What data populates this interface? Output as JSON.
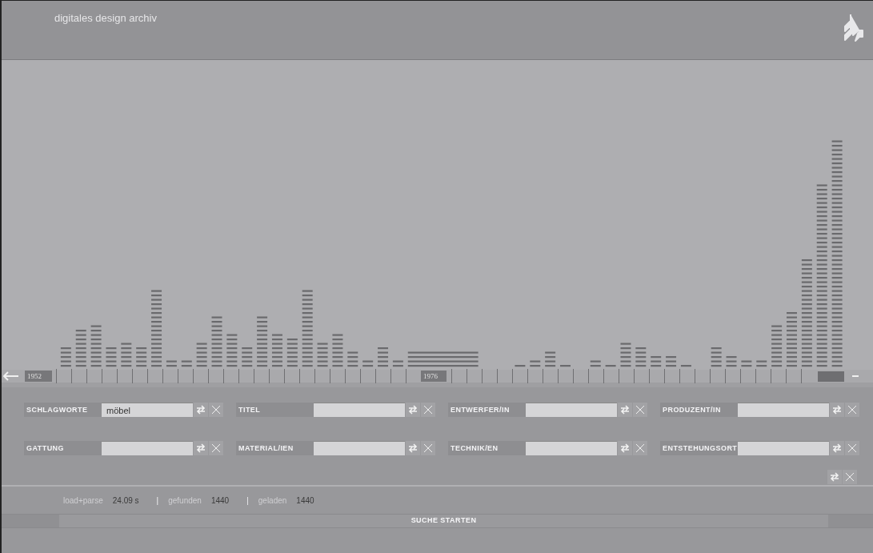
{
  "header": {
    "title": "digitales design archiv"
  },
  "timeline": {
    "start_label": "1952",
    "mid_label": "1976"
  },
  "fields": [
    {
      "label": "SCHLAGWORTE",
      "value": "möbel"
    },
    {
      "label": "TITEL"
    },
    {
      "label": "ENTWERFER/IN"
    },
    {
      "label": "PRODUZENT/IN"
    },
    {
      "label": "GATTUNG"
    },
    {
      "label": "MATERIAL/IEN"
    },
    {
      "label": "TECHNIK/EN"
    },
    {
      "label": "ENTSTEHUNGSORT"
    }
  ],
  "status": [
    {
      "label": "load+parse",
      "value": "24.09 s"
    },
    {
      "separator": "|",
      "label": "gefunden",
      "value": "1440"
    },
    {
      "separator": "|",
      "label": "geladen",
      "value": "1440"
    }
  ],
  "search_button": "SUCHE STARTEN"
}
